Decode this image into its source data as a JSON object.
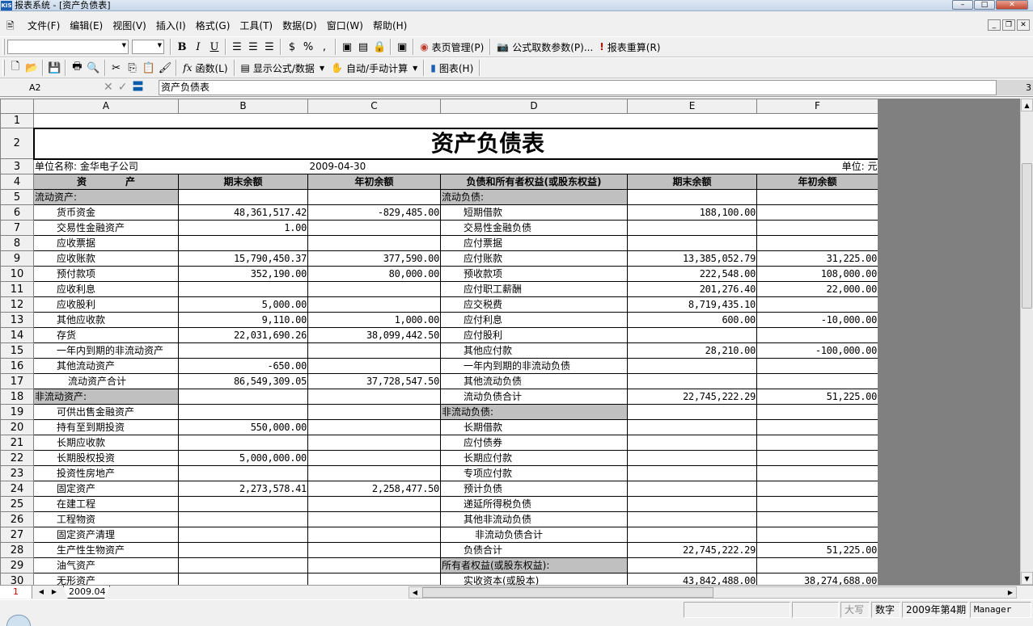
{
  "window": {
    "title": "报表系统 - [资产负债表]",
    "app_icon": "KIS",
    "buttons": {
      "minimize": "–",
      "maximize": "□",
      "close": "✕"
    },
    "mdi_buttons": {
      "minimize": "_",
      "restore": "❐",
      "close": "✕"
    }
  },
  "menu": [
    "文件(F)",
    "编辑(E)",
    "视图(V)",
    "插入(I)",
    "格式(G)",
    "工具(T)",
    "数据(D)",
    "窗口(W)",
    "帮助(H)"
  ],
  "toolbar1": {
    "font_name": "",
    "font_size": "",
    "bold": "B",
    "italic": "I",
    "underline": "U",
    "percent": "%",
    "comma": ",",
    "page_mgmt": "表页管理(P)",
    "formula_params": "公式取数参数(P)...",
    "recalc": "报表重算(R)"
  },
  "toolbar2": {
    "func": "函数(L)",
    "show_formula": "显示公式/数据",
    "auto_manual": "自动/手动计算",
    "chart": "图表(H)"
  },
  "formula_bar": {
    "cell_ref": "A2",
    "content": "资产负债表",
    "right_value": "3"
  },
  "columns": [
    "A",
    "B",
    "C",
    "D",
    "E",
    "F"
  ],
  "report": {
    "title": "资产负债表",
    "unit_name": "单位名称: 金华电子公司",
    "date": "2009-04-30",
    "unit": "单位: 元",
    "headers": [
      "资　　　　产",
      "期末余额",
      "年初余额",
      "负债和所有者权益(或股东权益)",
      "期末余额",
      "年初余额"
    ],
    "rows": [
      {
        "n": "5",
        "a": "流动资产:",
        "a_gray": true,
        "b": "",
        "c": "",
        "d": "流动负债:",
        "d_gray": true,
        "e": "",
        "f": ""
      },
      {
        "n": "6",
        "a": "货币资金",
        "ai": 1,
        "b": "48,361,517.42",
        "c": "-829,485.00",
        "d": "短期借款",
        "di": 1,
        "e": "188,100.00",
        "f": ""
      },
      {
        "n": "7",
        "a": "交易性金融资产",
        "ai": 1,
        "b": "1.00",
        "c": "",
        "d": "交易性金融负债",
        "di": 1,
        "e": "",
        "f": ""
      },
      {
        "n": "8",
        "a": "应收票据",
        "ai": 1,
        "b": "",
        "c": "",
        "d": "应付票据",
        "di": 1,
        "e": "",
        "f": ""
      },
      {
        "n": "9",
        "a": "应收账款",
        "ai": 1,
        "b": "15,790,450.37",
        "c": "377,590.00",
        "d": "应付账款",
        "di": 1,
        "e": "13,385,052.79",
        "f": "31,225.00"
      },
      {
        "n": "10",
        "a": "预付款项",
        "ai": 1,
        "b": "352,190.00",
        "c": "80,000.00",
        "d": "预收款项",
        "di": 1,
        "e": "222,548.00",
        "f": "108,000.00"
      },
      {
        "n": "11",
        "a": "应收利息",
        "ai": 1,
        "b": "",
        "c": "",
        "d": "应付职工薪酬",
        "di": 1,
        "e": "201,276.40",
        "f": "22,000.00"
      },
      {
        "n": "12",
        "a": "应收股利",
        "ai": 1,
        "b": "5,000.00",
        "c": "",
        "d": "应交税费",
        "di": 1,
        "e": "8,719,435.10",
        "f": ""
      },
      {
        "n": "13",
        "a": "其他应收款",
        "ai": 1,
        "b": "9,110.00",
        "c": "1,000.00",
        "d": "应付利息",
        "di": 1,
        "e": "600.00",
        "f": "-10,000.00"
      },
      {
        "n": "14",
        "a": "存货",
        "ai": 1,
        "b": "22,031,690.26",
        "c": "38,099,442.50",
        "d": "应付股利",
        "di": 1,
        "e": "",
        "f": ""
      },
      {
        "n": "15",
        "a": "一年内到期的非流动资产",
        "ai": 1,
        "b": "",
        "c": "",
        "d": "其他应付款",
        "di": 1,
        "e": "28,210.00",
        "f": "-100,000.00"
      },
      {
        "n": "16",
        "a": "其他流动资产",
        "ai": 1,
        "b": "-650.00",
        "c": "",
        "d": "一年内到期的非流动负债",
        "di": 1,
        "e": "",
        "f": ""
      },
      {
        "n": "17",
        "a": "流动资产合计",
        "ai": 2,
        "b": "86,549,309.05",
        "c": "37,728,547.50",
        "d": "其他流动负债",
        "di": 1,
        "e": "",
        "f": ""
      },
      {
        "n": "18",
        "a": "非流动资产:",
        "a_gray": true,
        "b": "",
        "c": "",
        "d": "流动负债合计",
        "di": 1,
        "e": "22,745,222.29",
        "f": "51,225.00"
      },
      {
        "n": "19",
        "a": "可供出售金融资产",
        "ai": 1,
        "b": "",
        "c": "",
        "d": "非流动负债:",
        "d_gray": true,
        "e": "",
        "f": ""
      },
      {
        "n": "20",
        "a": "持有至到期投资",
        "ai": 1,
        "b": "550,000.00",
        "c": "",
        "d": "长期借款",
        "di": 1,
        "e": "",
        "f": ""
      },
      {
        "n": "21",
        "a": "长期应收款",
        "ai": 1,
        "b": "",
        "c": "",
        "d": "应付债券",
        "di": 1,
        "e": "",
        "f": ""
      },
      {
        "n": "22",
        "a": "长期股权投资",
        "ai": 1,
        "b": "5,000,000.00",
        "c": "",
        "d": "长期应付款",
        "di": 1,
        "e": "",
        "f": ""
      },
      {
        "n": "23",
        "a": "投资性房地产",
        "ai": 1,
        "b": "",
        "c": "",
        "d": "专项应付款",
        "di": 1,
        "e": "",
        "f": ""
      },
      {
        "n": "24",
        "a": "固定资产",
        "ai": 1,
        "b": "2,273,578.41",
        "c": "2,258,477.50",
        "d": "预计负债",
        "di": 1,
        "e": "",
        "f": ""
      },
      {
        "n": "25",
        "a": "在建工程",
        "ai": 1,
        "b": "",
        "c": "",
        "d": "递延所得税负债",
        "di": 1,
        "e": "",
        "f": ""
      },
      {
        "n": "26",
        "a": "工程物资",
        "ai": 1,
        "b": "",
        "c": "",
        "d": "其他非流动负债",
        "di": 1,
        "e": "",
        "f": ""
      },
      {
        "n": "27",
        "a": "固定资产清理",
        "ai": 1,
        "b": "",
        "c": "",
        "d": "非流动负债合计",
        "di": 2,
        "e": "",
        "f": ""
      },
      {
        "n": "28",
        "a": "生产性生物资产",
        "ai": 1,
        "b": "",
        "c": "",
        "d": "负债合计",
        "di": 1,
        "e": "22,745,222.29",
        "f": "51,225.00"
      },
      {
        "n": "29",
        "a": "油气资产",
        "ai": 1,
        "b": "",
        "c": "",
        "d": "所有者权益(或股东权益):",
        "d_gray": true,
        "e": "",
        "f": ""
      },
      {
        "n": "30",
        "a": "无形资产",
        "ai": 1,
        "b": "",
        "c": "",
        "d": "实收资本(或股本)",
        "di": 1,
        "e": "43,842,488.00",
        "f": "38,274,688.00"
      }
    ]
  },
  "sheet_tab": {
    "row_indicator": "1",
    "name": "2009.04"
  },
  "status": {
    "caps": "大写",
    "num": "数字",
    "period": "2009年第4期",
    "user": "Manager"
  }
}
